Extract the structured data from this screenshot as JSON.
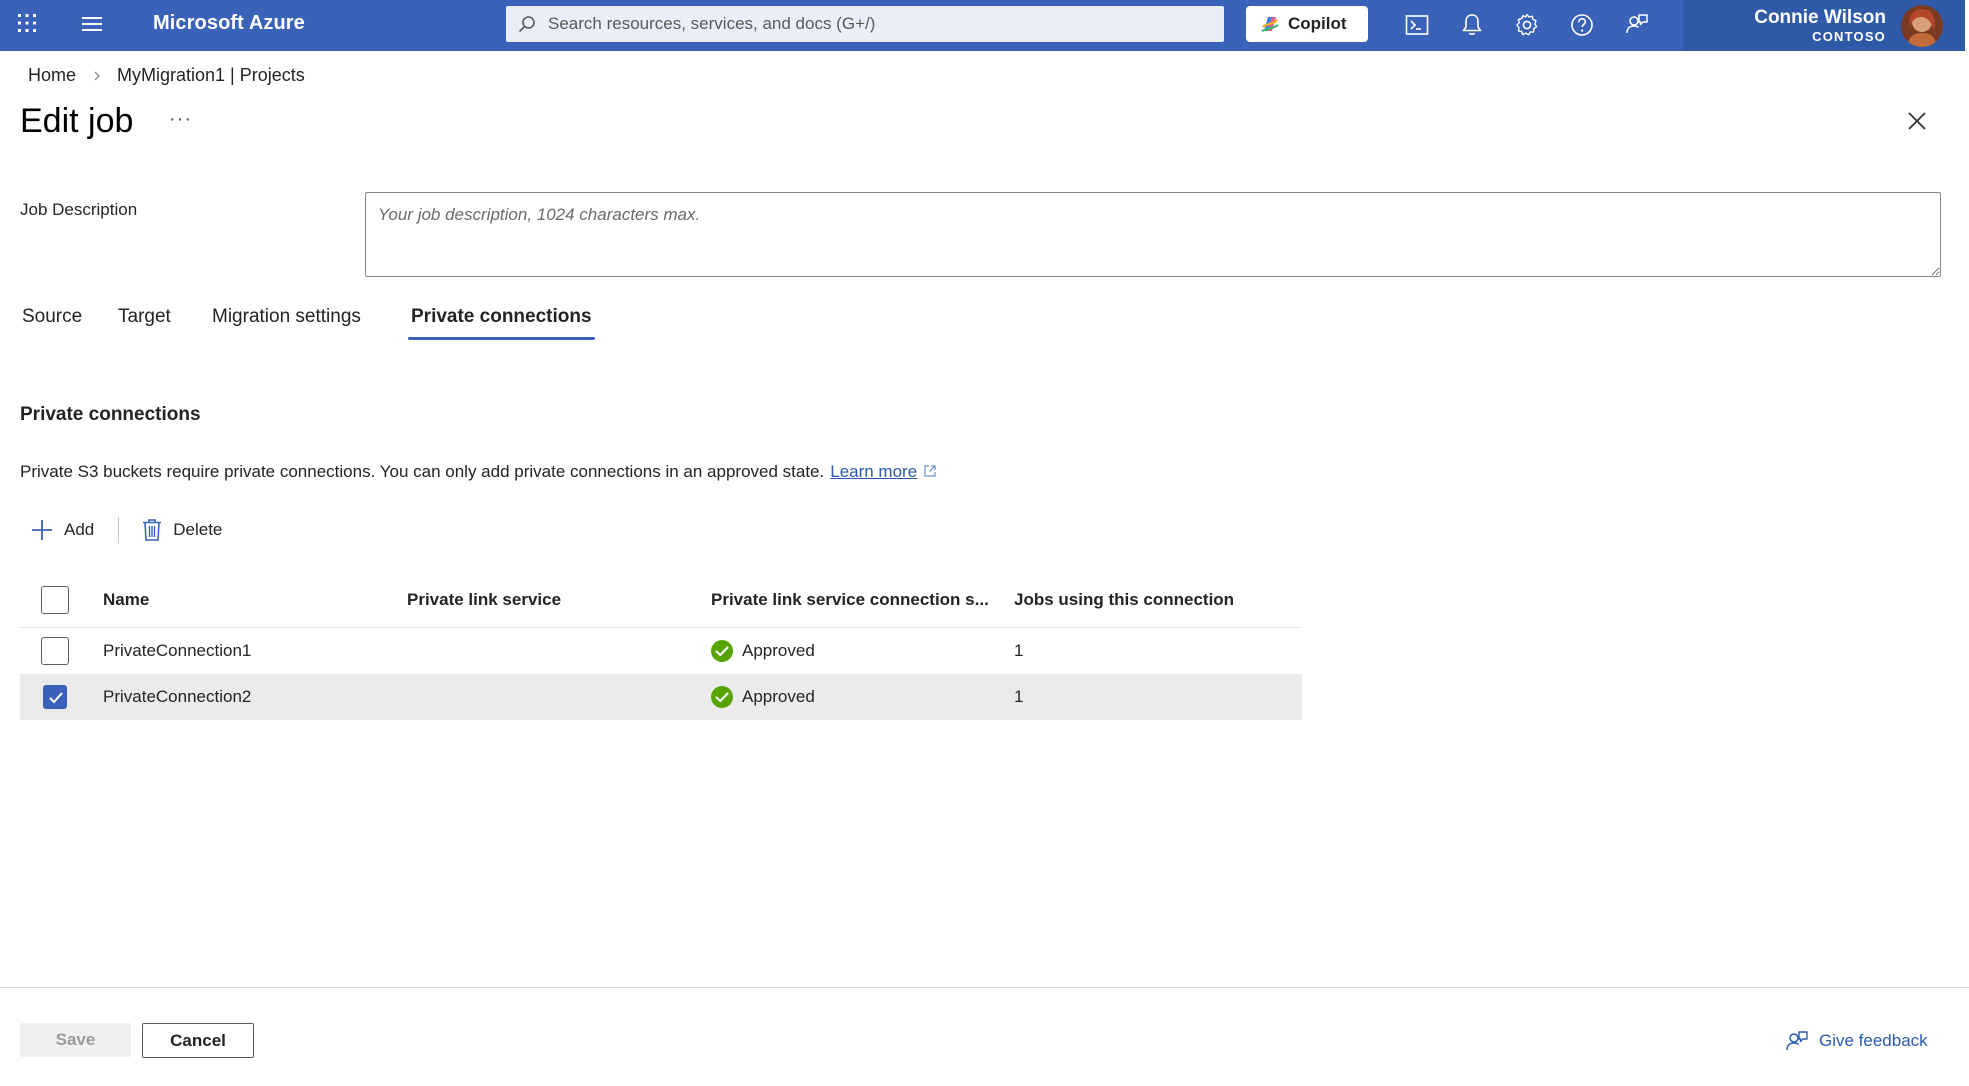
{
  "topbar": {
    "brand": "Microsoft Azure",
    "search_placeholder": "Search resources, services, and docs (G+/)",
    "copilot_label": "Copilot",
    "user_name": "Connie Wilson",
    "user_org": "CONTOSO"
  },
  "breadcrumb": {
    "home": "Home",
    "project": "MyMigration1 | Projects"
  },
  "page": {
    "title": "Edit job",
    "more": "···"
  },
  "job_description": {
    "label": "Job Description",
    "placeholder": "Your job description, 1024 characters max.",
    "value": ""
  },
  "tabs": [
    {
      "label": "Source",
      "active": false
    },
    {
      "label": "Target",
      "active": false
    },
    {
      "label": "Migration settings",
      "active": false
    },
    {
      "label": "Private connections",
      "active": true
    }
  ],
  "section": {
    "title": "Private connections",
    "description": "Private S3 buckets require private connections. You can only add private connections in an approved state.",
    "learn_more": "Learn more"
  },
  "commands": {
    "add": "Add",
    "delete": "Delete"
  },
  "grid": {
    "columns": [
      "Name",
      "Private link service",
      "Private link service connection s...",
      "Jobs using this connection"
    ],
    "rows": [
      {
        "name": "PrivateConnection1",
        "service": "",
        "status": "Approved",
        "jobs": "1",
        "selected": false
      },
      {
        "name": "PrivateConnection2",
        "service": "",
        "status": "Approved",
        "jobs": "1",
        "selected": true
      }
    ]
  },
  "footer": {
    "save": "Save",
    "cancel": "Cancel",
    "feedback": "Give feedback"
  },
  "colors": {
    "topbar": "#3a62b8",
    "accent": "#3a62b8",
    "link": "#2b5aad",
    "success": "#57a300"
  }
}
